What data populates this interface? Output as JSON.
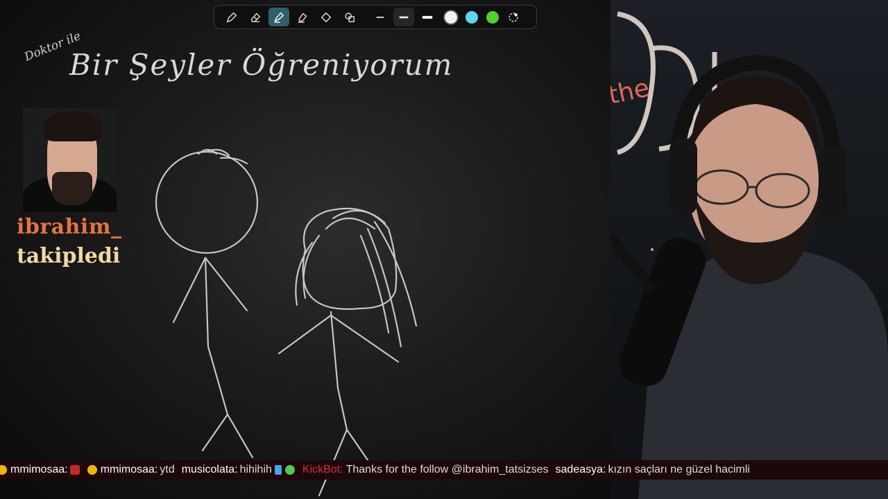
{
  "board": {
    "title_small": "Doktor ile",
    "title": "Bir Şeyler Öğreniyorum"
  },
  "toolbar": {
    "tools": [
      "pen-icon",
      "eraser-icon",
      "highlighter-icon",
      "marker-icon",
      "shape-diamond-icon",
      "shapes-icon"
    ],
    "active_tool": "highlighter-icon",
    "stroke_sizes": [
      "thin",
      "medium",
      "thick"
    ],
    "colors": [
      "#f2f2f2",
      "#5ad8ec",
      "#4fd12f"
    ],
    "extra": "color-picker-icon"
  },
  "alert": {
    "username": "ibrahim_",
    "action": "takipledi"
  },
  "chat": [
    {
      "user": "mmimosaa:",
      "text": "",
      "badge": "mask"
    },
    {
      "user": "mmimosaa:",
      "text": "ytd",
      "badge": "coin"
    },
    {
      "user": "musicolata:",
      "text": "hihihih",
      "badge": "sword"
    },
    {
      "user": "KickBot:",
      "text": "Thanks for the follow @ibrahim_tatsizses",
      "badge": "bot"
    },
    {
      "user": "sadeasya:",
      "text": "kızın saçları ne güzel hacimli",
      "badge": ""
    }
  ],
  "colors": {
    "ticker_bg": "#1c080b",
    "alert_user": "#e5743f",
    "alert_action": "#f2d9a1",
    "bot_name": "#d42c2c",
    "toolbar_active": "#2f5f6a"
  }
}
